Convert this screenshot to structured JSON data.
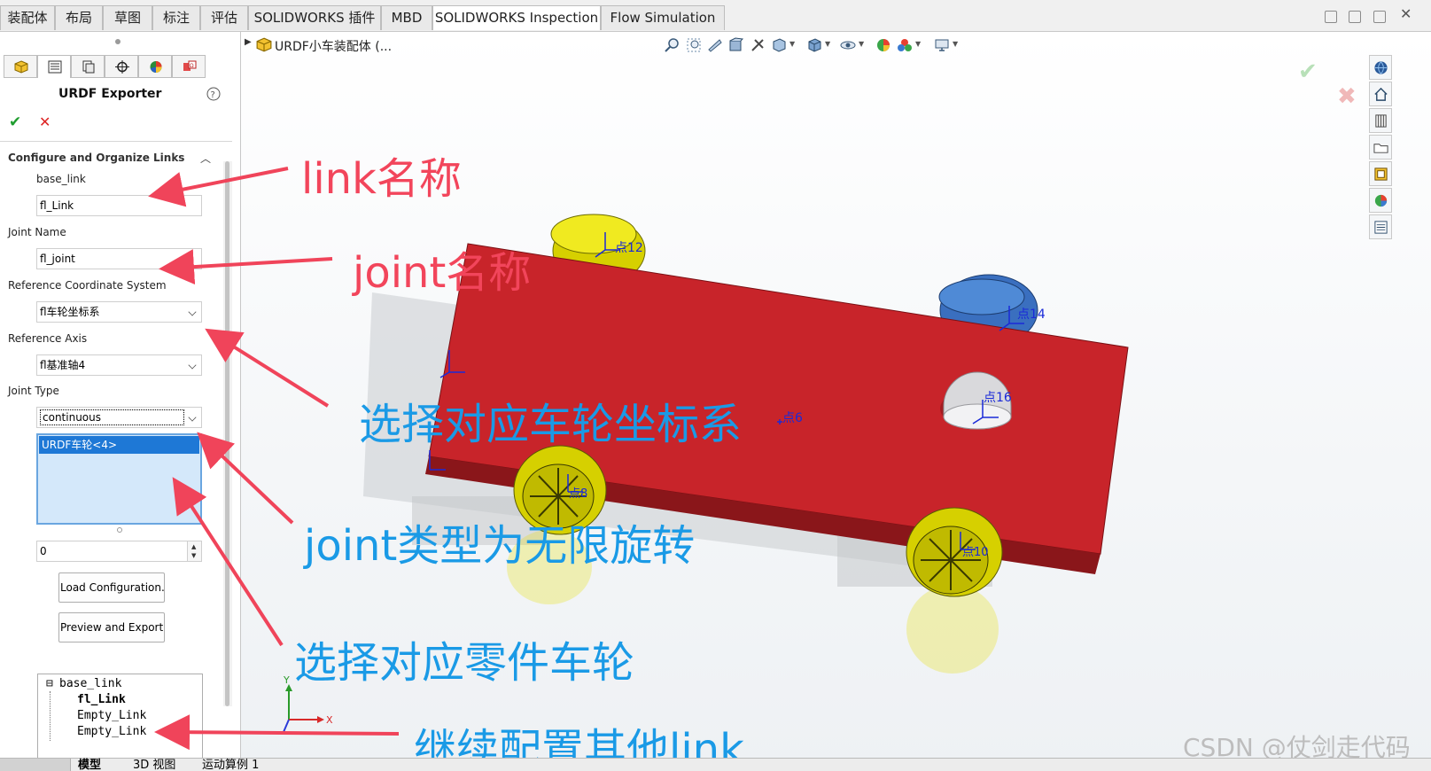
{
  "tabs": [
    "装配体",
    "布局",
    "草图",
    "标注",
    "评估",
    "SOLIDWORKS 插件",
    "MBD",
    "SOLIDWORKS Inspection",
    "Flow Simulation"
  ],
  "active_tab": "SOLIDWORKS Inspection",
  "tree_breadcrumb": "URDF小车装配体 (...",
  "panel": {
    "title": "URDF Exporter",
    "help_icon": "question-circle-icon",
    "section_title": "Configure and Organize Links",
    "link_parent": "base_link",
    "link_name": "fl_Link",
    "joint_name_label": "Joint Name",
    "joint_name": "fl_joint",
    "ref_coord_label": "Reference Coordinate System",
    "ref_coord_value": "fl车轮坐标系",
    "ref_axis_label": "Reference Axis",
    "ref_axis_value": "fl基准轴4",
    "joint_type_label": "Joint Type",
    "joint_type_value": "continuous",
    "selected_component": "URDF车轮<4>",
    "spinner_value": "0",
    "load_button": "Load Configuration..",
    "export_button": "Preview and Export..",
    "tree": {
      "root": "base_link",
      "children": [
        "fl_Link",
        "Empty_Link",
        "Empty_Link"
      ]
    }
  },
  "viewport_labels": {
    "p12": "点12",
    "p14": "点14",
    "p16": "点16",
    "p6": "点6",
    "p8": "点8",
    "p10": "点10",
    "axis_x": "X",
    "axis_y": "Y"
  },
  "annotations": {
    "link_name": "link名称",
    "joint_name": "joint名称",
    "select_coord": "选择对应车轮坐标系",
    "joint_type": "joint类型为无限旋转",
    "select_part": "选择对应零件车轮",
    "continue": "继续配置其他link"
  },
  "watermark": "CSDN @仗剑走代码",
  "bottom_tabs": [
    "模型",
    "3D 视图",
    "运动算例 1"
  ],
  "colors": {
    "body": "#c8242a",
    "wheel": "#e6e000",
    "selected_wheel": "#3c78c8",
    "annotation_red": "#f2455b",
    "annotation_blue": "#1a9ae6",
    "arrow_red": "#f0445a"
  }
}
